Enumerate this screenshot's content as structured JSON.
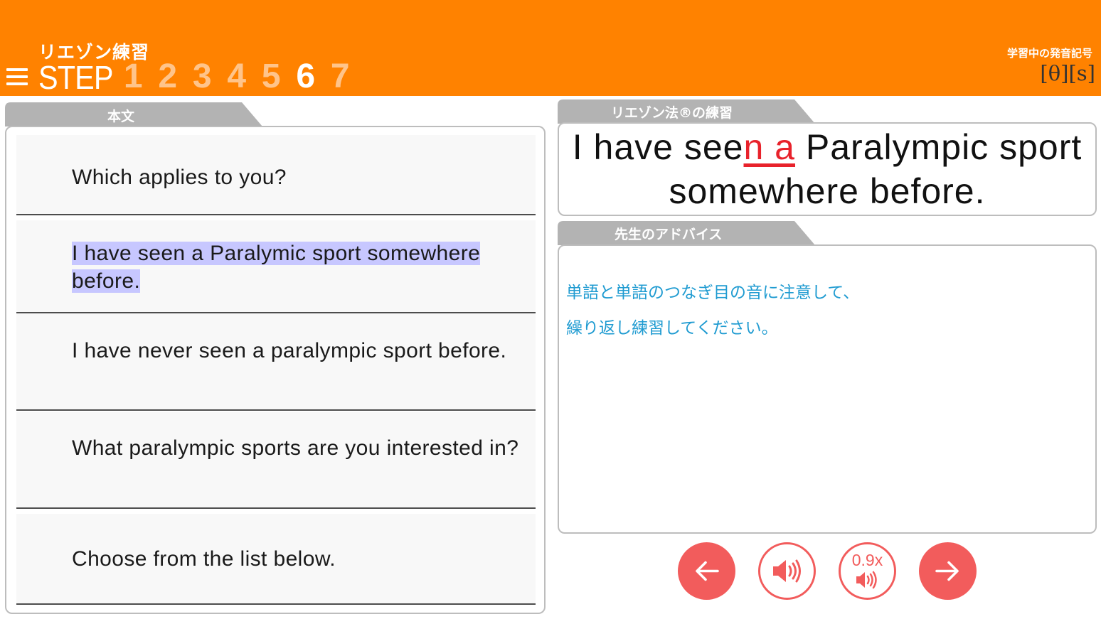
{
  "header": {
    "lesson_title": "リエゾン練習",
    "step_label": "STEP",
    "steps": [
      "1",
      "2",
      "3",
      "4",
      "5",
      "6",
      "7"
    ],
    "active_step": "6",
    "phonetic_label": "学習中の発音記号",
    "phonetic_symbols": "[θ][s]"
  },
  "main_text": {
    "tab_label": "本文",
    "rows": [
      {
        "text": "Which applies to you?"
      },
      {
        "text": "I have seen a Paralymic sport somewhere before.",
        "highlighted": true
      },
      {
        "text": "I have never seen a paralympic sport before."
      },
      {
        "text": "What paralympic sports are you interested in?"
      },
      {
        "text": "Choose from the list below."
      }
    ]
  },
  "liaison": {
    "tab_label": "リエゾン法®の練習",
    "sentence_before": "I have see",
    "sentence_liaison": "n a",
    "sentence_after": " Paralympic sport somewhere before."
  },
  "advice": {
    "tab_label": "先生のアドバイス",
    "lines": [
      "単語と単語のつなぎ目の音に注意して、",
      "繰り返し練習してください。"
    ]
  },
  "controls": {
    "speed_label": "0.9x"
  },
  "colors": {
    "header_bg": "#ff8200",
    "inactive_step": "#ffc48a",
    "tab_gray": "#b3b3b3",
    "highlight": "#c7c7ff",
    "liaison_red": "#e8222b",
    "advice_blue": "#1f9bd1",
    "button_red": "#f25c5c"
  },
  "icons": [
    "menu-icon",
    "arrow-left-icon",
    "speaker-icon",
    "slow-speaker-icon",
    "arrow-right-icon"
  ]
}
